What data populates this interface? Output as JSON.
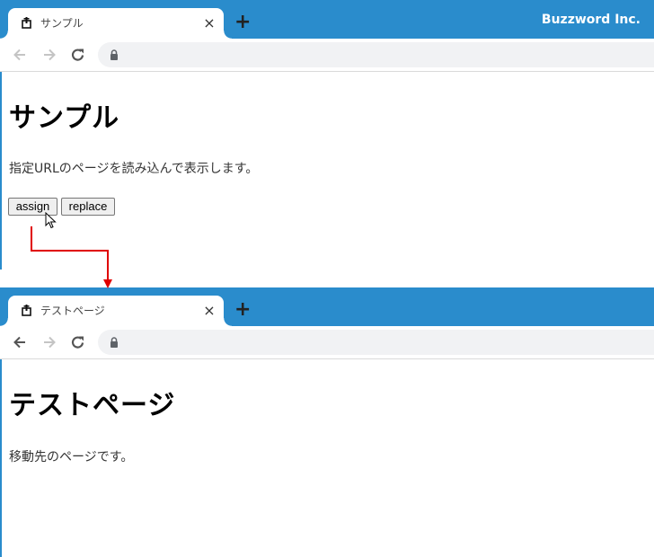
{
  "before": {
    "tab": {
      "title": "サンプル",
      "favicon": "page-favicon",
      "close_icon": "×"
    },
    "new_tab_icon": "+",
    "brand": "Buzzword Inc.",
    "toolbar": {
      "back_enabled": false,
      "forward_enabled": false,
      "url": ""
    },
    "page": {
      "heading": "サンプル",
      "description": "指定URLのページを読み込んで表示します。",
      "buttons": [
        {
          "label": "assign"
        },
        {
          "label": "replace"
        }
      ]
    }
  },
  "after": {
    "tab": {
      "title": "テストページ",
      "favicon": "page-favicon",
      "close_icon": "×"
    },
    "new_tab_icon": "+",
    "toolbar": {
      "back_enabled": true,
      "forward_enabled": false,
      "url": ""
    },
    "page": {
      "heading": "テストページ",
      "description": "移動先のページです。"
    }
  },
  "annotation": {
    "arrow_color": "#e00000",
    "meaning": "assign-click-navigates"
  },
  "colors": {
    "tabstrip": "#2a8ccc",
    "omnibox": "#f1f2f4"
  }
}
